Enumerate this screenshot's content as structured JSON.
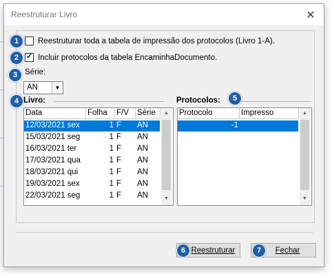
{
  "dialog": {
    "title": "Reestruturar Livro",
    "close_glyph": "✕"
  },
  "options": {
    "restructure_all": {
      "label": "Reestruturar toda a tabela de impressão dos protocolos (Livro 1-A).",
      "checked": false
    },
    "include_encaminha": {
      "label": "Incluir protocolos da tabela EncaminhaDocumento.",
      "checked": true
    }
  },
  "serie": {
    "label": "Série:",
    "selected": "AN"
  },
  "livro": {
    "label": "Livro:",
    "columns": [
      "Data",
      "Folha",
      "F/V",
      "Série"
    ],
    "rows": [
      [
        "12/03/2021 sex",
        "1",
        "F",
        "AN"
      ],
      [
        "15/03/2021 seg",
        "1",
        "F",
        "AN"
      ],
      [
        "16/03/2021 ter",
        "1",
        "F",
        "AN"
      ],
      [
        "17/03/2021 qua",
        "1",
        "F",
        "AN"
      ],
      [
        "18/03/2021 qui",
        "1",
        "F",
        "AN"
      ],
      [
        "19/03/2021 sex",
        "1",
        "F",
        "AN"
      ],
      [
        "22/03/2021 seg",
        "1",
        "F",
        "AN"
      ]
    ],
    "selected_row": 0
  },
  "protocolos": {
    "label": "Protocolos:",
    "columns": [
      "Protocolo",
      "Impresso"
    ],
    "rows": [
      [
        "-1",
        ""
      ]
    ],
    "selected_row": 0
  },
  "buttons": {
    "restructure": "Reestruturar",
    "close": "Fechar"
  },
  "badges": [
    "1",
    "2",
    "3",
    "4",
    "5",
    "6",
    "7"
  ],
  "colors": {
    "badge": "#1f5fa8",
    "selection": "#0078d7"
  }
}
